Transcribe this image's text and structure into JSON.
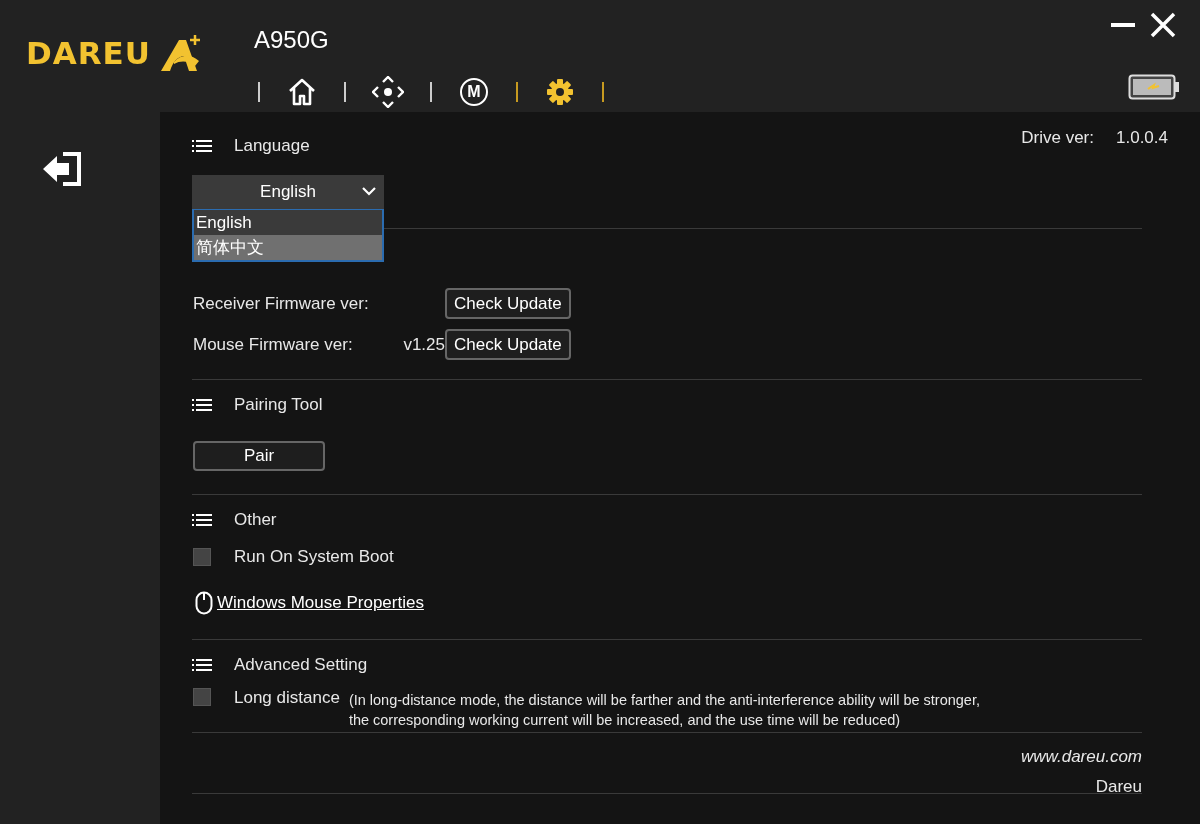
{
  "header": {
    "logo": "DAREU",
    "model": "A950G",
    "nav_tabs": [
      {
        "kind": "home",
        "selected": false
      },
      {
        "kind": "dpad",
        "selected": false
      },
      {
        "kind": "macro",
        "label": "M",
        "selected": false
      },
      {
        "kind": "settings",
        "selected": true
      }
    ]
  },
  "drive_version": {
    "label": "Drive ver:",
    "value": "1.0.0.4"
  },
  "language": {
    "heading": "Language",
    "dropdown": {
      "value": "English",
      "expanded": true,
      "options": [
        {
          "label": "English",
          "hovered": false
        },
        {
          "label": "简体中文",
          "hovered": true
        }
      ]
    }
  },
  "firmware": {
    "rows": [
      {
        "label": "Receiver Firmware ver:",
        "button": "Check Update"
      },
      {
        "label": "Mouse Firmware ver:",
        "version": "v1.25",
        "button": "Check Update"
      }
    ]
  },
  "pairing_tool": {
    "heading": "Pairing Tool",
    "button": "Pair"
  },
  "other": {
    "heading": "Other",
    "run_on_boot": {
      "label": "Run On System Boot",
      "checked": false
    },
    "link": "Windows Mouse Properties"
  },
  "advanced_setting": {
    "heading": "Advanced Setting",
    "long_distance": {
      "label": "Long distance",
      "checked": false,
      "note": "(In long-distance mode, the distance will be farther and the anti-interference ability will be stronger,\nthe corresponding working current will be increased, and the use time will be reduced)"
    }
  },
  "footer": {
    "website": "www.dareu.com",
    "brand": "Dareu"
  }
}
